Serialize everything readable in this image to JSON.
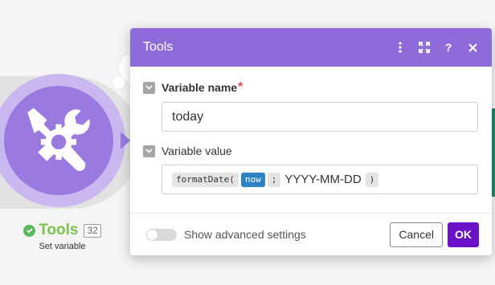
{
  "module": {
    "name": "Tools",
    "badge": "32",
    "subtitle": "Set variable",
    "icon": "tools-icon",
    "status_icon": "check-circle-icon",
    "color": "#9a79e0"
  },
  "dialog": {
    "title": "Tools",
    "header_actions": [
      "more-vertical-icon",
      "expand-icon",
      "help-icon",
      "close-icon"
    ],
    "header_color": "#8e6bd8",
    "fields": {
      "variable_name": {
        "label": "Variable name",
        "required_mark": "*",
        "value": "today"
      },
      "variable_value": {
        "label": "Variable value",
        "tokens": {
          "fn_open": "formatDate(",
          "now": "now",
          "separator": ";",
          "format": "YYYY-MM-DD",
          "fn_close": ")"
        }
      }
    },
    "footer": {
      "advanced_label": "Show advanced settings",
      "advanced_enabled": false,
      "cancel_label": "Cancel",
      "ok_label": "OK",
      "ok_color": "#6b12c9"
    }
  }
}
